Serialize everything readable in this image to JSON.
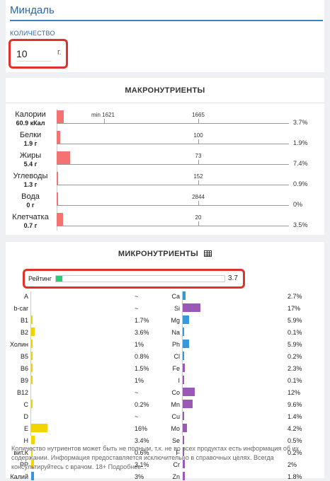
{
  "header": {
    "title": "Миндаль"
  },
  "quantity": {
    "label": "КОЛИЧЕСТВО",
    "value": "10",
    "unit": "г."
  },
  "macro": {
    "title": "МАКРОНУТРИЕНТЫ",
    "min_label": "min 1621",
    "rows": [
      {
        "name": "Калории",
        "sub": "60.9 кКал",
        "max": "1665",
        "pct": "3.7%",
        "fraction": 0.037
      },
      {
        "name": "Белки",
        "sub": "1.9 г",
        "max": "100",
        "pct": "1.9%",
        "fraction": 0.019
      },
      {
        "name": "Жиры",
        "sub": "5.4 г",
        "max": "73",
        "pct": "7.4%",
        "fraction": 0.074
      },
      {
        "name": "Углеводы",
        "sub": "1.3 г",
        "max": "152",
        "pct": "0.9%",
        "fraction": 0.009
      },
      {
        "name": "Вода",
        "sub": "0 г",
        "max": "2844",
        "pct": "0%",
        "fraction": 0.0
      },
      {
        "name": "Клетчатка",
        "sub": "0.7 г",
        "max": "20",
        "pct": "3.5%",
        "fraction": 0.035
      }
    ]
  },
  "micro": {
    "title": "МИКРОНУТРИЕНТЫ",
    "rating_label": "Рейтинг",
    "rating_value": "3.7",
    "rating_max": 100,
    "vitamin_color": "#f1d400",
    "left": [
      {
        "name": "A",
        "value": "~",
        "pct": 0
      },
      {
        "name": "b-car",
        "value": "~",
        "pct": 0
      },
      {
        "name": "B1",
        "value": "1.7%",
        "pct": 1.7
      },
      {
        "name": "B2",
        "value": "3.6%",
        "pct": 3.6
      },
      {
        "name": "Холин",
        "value": "1%",
        "pct": 1
      },
      {
        "name": "B5",
        "value": "0.8%",
        "pct": 0.8
      },
      {
        "name": "B6",
        "value": "1.5%",
        "pct": 1.5
      },
      {
        "name": "B9",
        "value": "1%",
        "pct": 1
      },
      {
        "name": "B12",
        "value": "~",
        "pct": 0
      },
      {
        "name": "C",
        "value": "0.2%",
        "pct": 0.2
      },
      {
        "name": "D",
        "value": "~",
        "pct": 0
      },
      {
        "name": "E",
        "value": "16%",
        "pct": 16
      },
      {
        "name": "H",
        "value": "3.4%",
        "pct": 3.4
      },
      {
        "name": "вит.К",
        "value": "0.6%",
        "pct": 0.6
      },
      {
        "name": "PP",
        "value": "3.1%",
        "pct": 3.1
      },
      {
        "name": "Калий",
        "value": "3%",
        "pct": 3,
        "color": "#3498db"
      }
    ],
    "right": [
      {
        "name": "Ca",
        "value": "2.7%",
        "pct": 2.7,
        "color": "#3498db"
      },
      {
        "name": "Si",
        "value": "17%",
        "pct": 17,
        "color": "#9b59b6"
      },
      {
        "name": "Mg",
        "value": "5.9%",
        "pct": 5.9,
        "color": "#3498db"
      },
      {
        "name": "Na",
        "value": "0.1%",
        "pct": 0.1,
        "color": "#3498db"
      },
      {
        "name": "Ph",
        "value": "5.9%",
        "pct": 5.9,
        "color": "#3498db"
      },
      {
        "name": "Cl",
        "value": "0.2%",
        "pct": 0.2,
        "color": "#3498db"
      },
      {
        "name": "Fe",
        "value": "2.3%",
        "pct": 2.3,
        "color": "#9b59b6"
      },
      {
        "name": "I",
        "value": "0.1%",
        "pct": 0.1,
        "color": "#9b59b6"
      },
      {
        "name": "Co",
        "value": "12%",
        "pct": 12,
        "color": "#9b59b6"
      },
      {
        "name": "Mn",
        "value": "9.6%",
        "pct": 9.6,
        "color": "#9b59b6"
      },
      {
        "name": "Cu",
        "value": "1.4%",
        "pct": 1.4,
        "color": "#9b59b6"
      },
      {
        "name": "Mo",
        "value": "4.2%",
        "pct": 4.2,
        "color": "#9b59b6"
      },
      {
        "name": "Se",
        "value": "0.5%",
        "pct": 0.5,
        "color": "#9b59b6"
      },
      {
        "name": "F",
        "value": "0.2%",
        "pct": 0.2,
        "color": "#9b59b6"
      },
      {
        "name": "Cr",
        "value": "2%",
        "pct": 2,
        "color": "#9b59b6"
      },
      {
        "name": "Zn",
        "value": "1.8%",
        "pct": 1.8,
        "color": "#9b59b6"
      }
    ],
    "disclaimer": "Количество нутриентов может быть не полным, т.к. не во всех продуктах есть информация об их содержании. Информация предоставляется исключительно в справочных целях. Всегда консультируйтесь с врачом. 18+ Подробнее..."
  }
}
